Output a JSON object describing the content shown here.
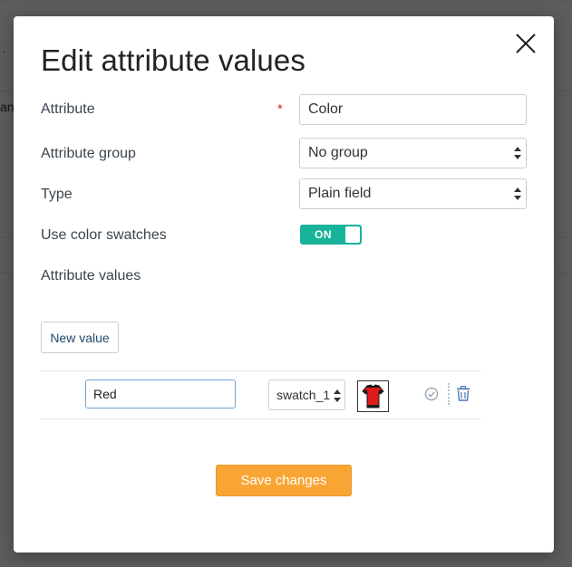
{
  "background": {
    "fragment_dot": "·",
    "fragment_text": "an"
  },
  "modal": {
    "title": "Edit attribute values",
    "close_icon": "close-icon"
  },
  "form": {
    "attribute_label": "Attribute",
    "required_mark": "*",
    "attribute_value": "Color",
    "group_label": "Attribute group",
    "group_value": "No group",
    "type_label": "Type",
    "type_value": "Plain field",
    "swatches_label": "Use color swatches",
    "swatches_toggle": "ON",
    "swatches_enabled": true,
    "values_label": "Attribute values"
  },
  "values": {
    "new_button": "New value",
    "rows": [
      {
        "value": "Red",
        "swatch": "swatch_1",
        "thumbnail_icon": "red-tshirt-icon",
        "check_icon": "check-circle-icon",
        "delete_icon": "trash-icon"
      }
    ]
  },
  "footer": {
    "save_button": "Save changes"
  },
  "colors": {
    "accent_toggle": "#18b39b",
    "save_button": "#f9a534",
    "required": "#d0312d",
    "link_text": "#234a6d"
  }
}
